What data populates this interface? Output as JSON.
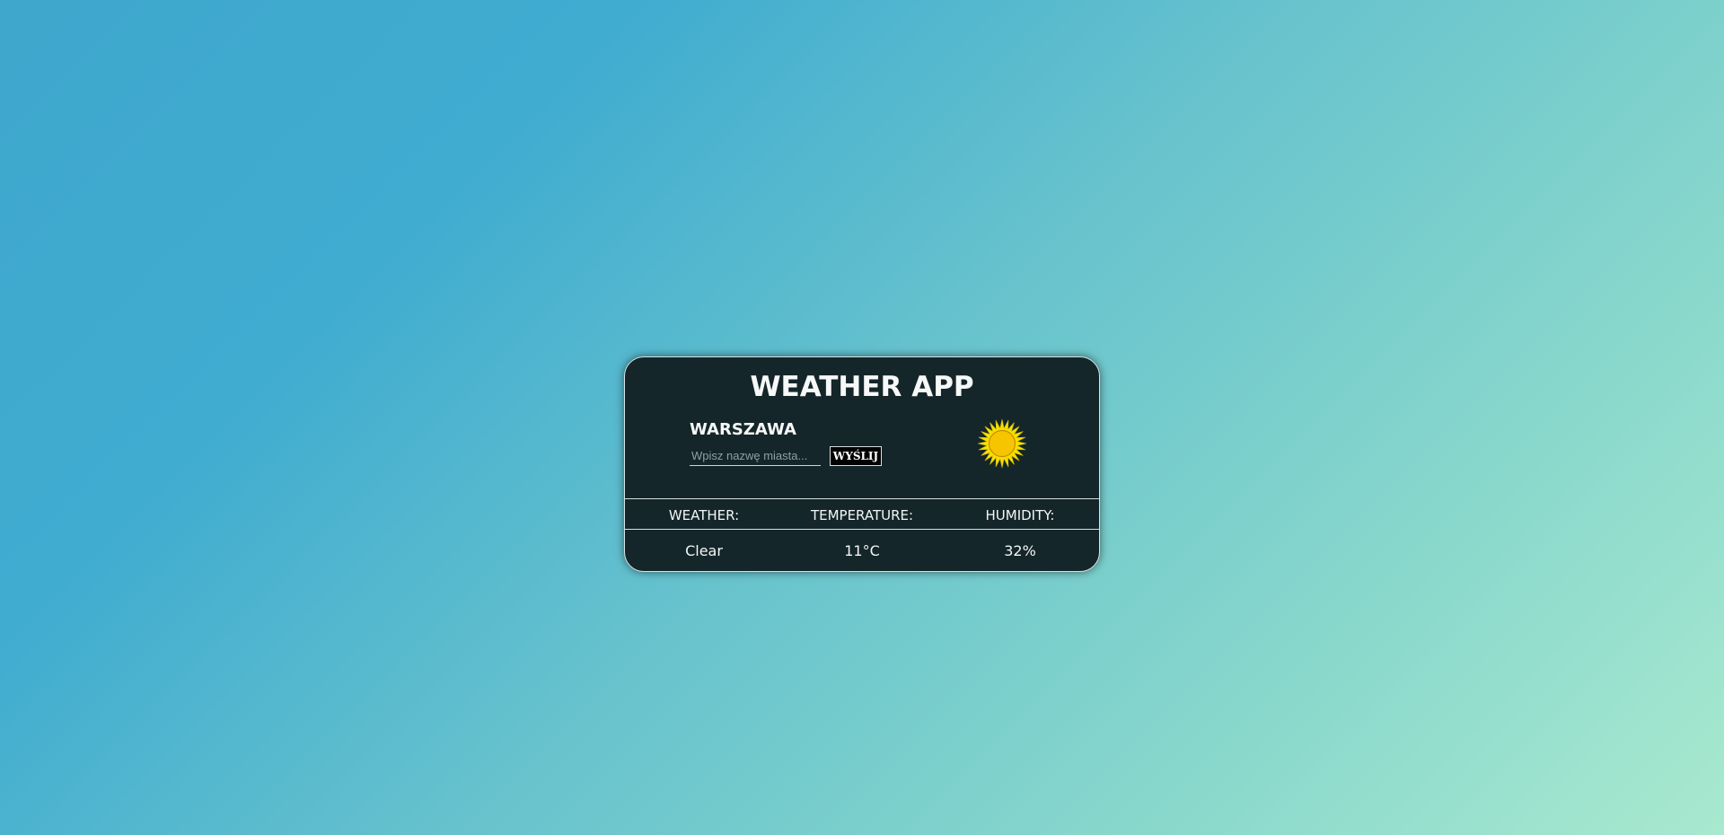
{
  "app": {
    "title": "WEATHER APP"
  },
  "location": {
    "city": "WARSZAWA"
  },
  "search": {
    "placeholder": "Wpisz nazwę miasta...",
    "value": "",
    "button_label": "WYŚLIJ"
  },
  "weather_icon": {
    "name": "sun-icon",
    "color_rays": "#f5e000",
    "color_disc": "#f7c400"
  },
  "table": {
    "headers": [
      "WEATHER:",
      "TEMPERATURE:",
      "HUMIDITY:"
    ],
    "values": [
      "Clear",
      "11°C",
      "32%"
    ]
  },
  "colors": {
    "card_background": "#15262a",
    "card_border": "#d9e3e6",
    "gradient_start": "#3fa6cc",
    "gradient_end": "#a8e9cf"
  }
}
